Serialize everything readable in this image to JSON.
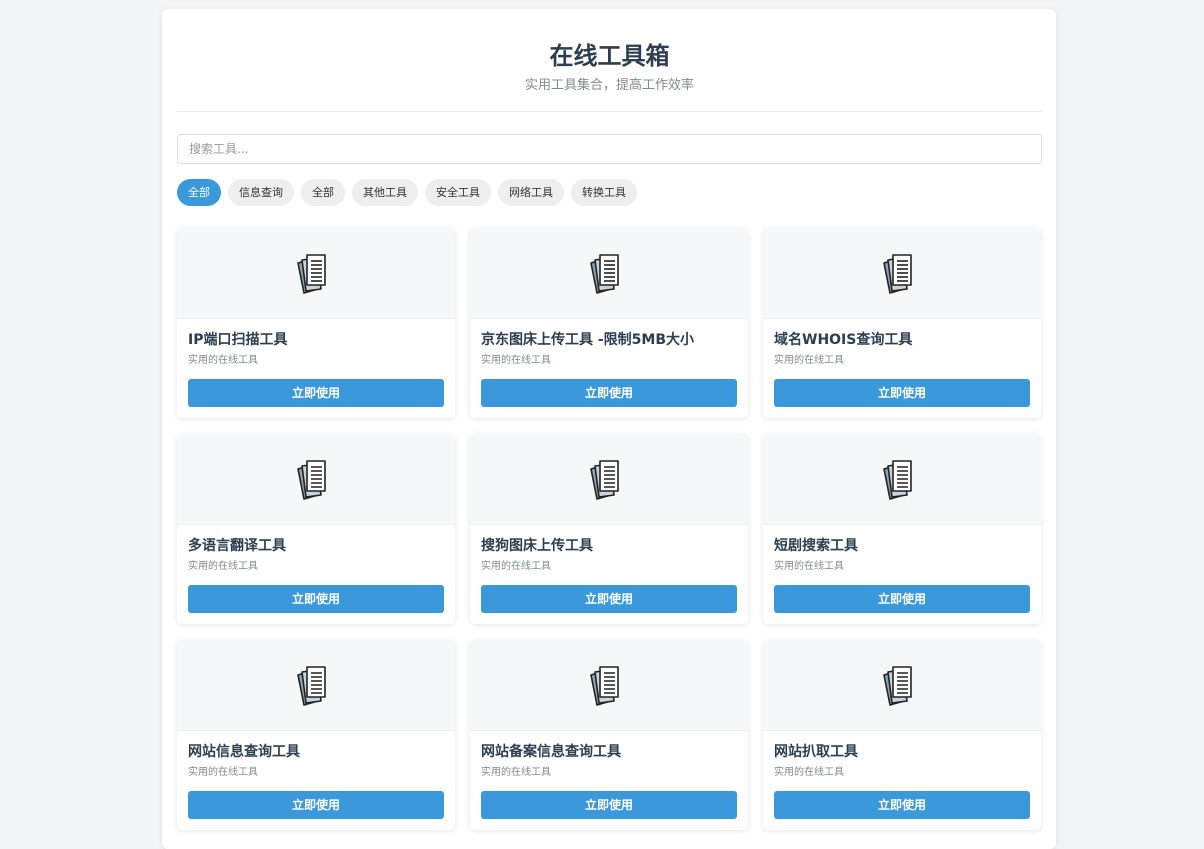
{
  "header": {
    "title": "在线工具箱",
    "subtitle": "实用工具集合，提高工作效率"
  },
  "search": {
    "placeholder": "搜索工具..."
  },
  "filters": [
    {
      "label": "全部",
      "active": true
    },
    {
      "label": "信息查询",
      "active": false
    },
    {
      "label": "全部",
      "active": false
    },
    {
      "label": "其他工具",
      "active": false
    },
    {
      "label": "安全工具",
      "active": false
    },
    {
      "label": "网络工具",
      "active": false
    },
    {
      "label": "转换工具",
      "active": false
    }
  ],
  "cards": [
    {
      "title": "IP端口扫描工具",
      "desc": "实用的在线工具",
      "button": "立即使用",
      "icon": "documents-icon"
    },
    {
      "title": "京东图床上传工具 -限制5MB大小",
      "desc": "实用的在线工具",
      "button": "立即使用",
      "icon": "documents-icon"
    },
    {
      "title": "域名WHOIS查询工具",
      "desc": "实用的在线工具",
      "button": "立即使用",
      "icon": "documents-icon"
    },
    {
      "title": "多语言翻译工具",
      "desc": "实用的在线工具",
      "button": "立即使用",
      "icon": "documents-icon"
    },
    {
      "title": "搜狗图床上传工具",
      "desc": "实用的在线工具",
      "button": "立即使用",
      "icon": "documents-icon"
    },
    {
      "title": "短剧搜索工具",
      "desc": "实用的在线工具",
      "button": "立即使用",
      "icon": "documents-icon"
    },
    {
      "title": "网站信息查询工具",
      "desc": "实用的在线工具",
      "button": "立即使用",
      "icon": "documents-icon"
    },
    {
      "title": "网站备案信息查询工具",
      "desc": "实用的在线工具",
      "button": "立即使用",
      "icon": "documents-icon"
    },
    {
      "title": "网站扒取工具",
      "desc": "实用的在线工具",
      "button": "立即使用",
      "icon": "documents-icon"
    }
  ],
  "colors": {
    "accent": "#3a98db",
    "title": "#2c3e50",
    "muted": "#7f8c8d"
  }
}
